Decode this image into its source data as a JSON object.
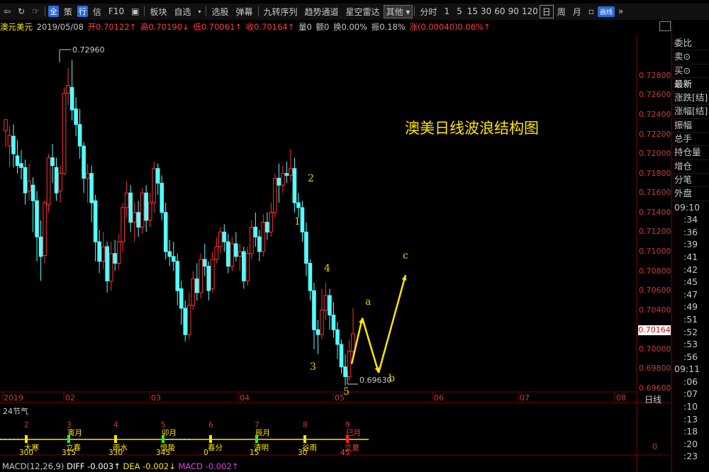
{
  "toolbar": {
    "items": [
      "全",
      "策",
      "行",
      "信",
      "F10",
      "板块",
      "自选",
      "选股",
      "弹幕",
      "九转序列",
      "趋势通道",
      "星空雷达",
      "其他"
    ],
    "periods": [
      "分时",
      "1",
      "5",
      "15",
      "30",
      "60",
      "90",
      "120",
      "日",
      "周",
      "月"
    ],
    "selected_period": "日",
    "tag": "画线"
  },
  "info": {
    "symbol": "澳元美元",
    "date": "2019/05/08",
    "open": "开0.70122↑",
    "high": "高0.70190↓",
    "low": "低0.70061↑",
    "close": "收0.70164↑",
    "volume": "量0",
    "amount": "额0",
    "turnover": "换0.00%",
    "amplitude": "振0.18%",
    "change": "涨(0.00040)0.06%↑"
  },
  "right_panel": {
    "fields": [
      "委比",
      "卖⊙",
      "买⊙",
      "最新",
      "涨跌[结]",
      "涨幅[结]",
      "振幅",
      "总手",
      "持仓量",
      "增仓",
      "分笔",
      "外盘"
    ],
    "time_header": "09:10",
    "ticks": [
      ":34",
      ":36",
      ":39",
      ":41",
      ":42",
      ":45",
      ":47",
      ":49",
      ":51",
      ":52",
      ":53",
      ":56"
    ],
    "time_header2": "09:11",
    "ticks2": [
      ":06",
      ":07",
      ":10",
      ":13",
      ":18",
      ":20",
      ":23"
    ]
  },
  "annotation_title": "澳美日线波浪结构图",
  "wave_labels": [
    "1",
    "2",
    "3",
    "4",
    "5",
    "a",
    "b",
    "c"
  ],
  "high_label": "0.72960",
  "low_label": "0.69630",
  "current_price": "0.70164",
  "period_label": "日线",
  "solar_terms": {
    "title": "24节气",
    "months": [
      "寅月",
      "卯月",
      "辰月",
      "巳月"
    ],
    "terms": [
      "大寒",
      "立春",
      "雨水",
      "惊蛰",
      "春分",
      "清明",
      "谷雨",
      "立夏"
    ],
    "numbers_top": [
      "2",
      "3",
      "4",
      "5",
      "6",
      "7",
      "8",
      "9"
    ],
    "numbers_bottom": [
      "300",
      "315",
      "330",
      "345",
      "0",
      "15",
      "30",
      "45"
    ],
    "value": "0"
  },
  "macd": {
    "label": "MACD(12,26,9)",
    "diff": "DIFF -0.003↑",
    "dea": "DEA -0.002↓",
    "macd": "MACD -0.002↑"
  },
  "chart_data": {
    "type": "candlestick",
    "title": "澳美日线波浪结构图",
    "y_axis_ticks": [
      "0.72800",
      "0.72600",
      "0.72400",
      "0.72200",
      "0.72000",
      "0.71800",
      "0.71600",
      "0.71400",
      "0.71200",
      "0.71000",
      "0.70800",
      "0.70600",
      "0.70400",
      "0.70200",
      "0.70000",
      "0.69800",
      "0.69600"
    ],
    "x_axis_ticks": [
      "2019",
      "02",
      "03",
      "04",
      "05",
      "06",
      "07",
      "08"
    ],
    "ylim": [
      0.6955,
      0.7318
    ],
    "candles": [
      [
        0.7224,
        0.7235,
        0.7212,
        0.7207
      ],
      [
        0.7208,
        0.7219,
        0.7228,
        0.7186
      ],
      [
        0.7218,
        0.72,
        0.723,
        0.7186
      ],
      [
        0.7198,
        0.7188,
        0.7214,
        0.718
      ],
      [
        0.719,
        0.7186,
        0.7204,
        0.7174
      ],
      [
        0.7186,
        0.716,
        0.7194,
        0.7148
      ],
      [
        0.7162,
        0.7172,
        0.719,
        0.7152
      ],
      [
        0.7168,
        0.7152,
        0.7176,
        0.712
      ],
      [
        0.7152,
        0.7115,
        0.7162,
        0.709
      ],
      [
        0.7115,
        0.7095,
        0.7132,
        0.707
      ],
      [
        0.7096,
        0.715,
        0.7152,
        0.7088
      ],
      [
        0.7148,
        0.7196,
        0.72,
        0.714
      ],
      [
        0.7196,
        0.7188,
        0.721,
        0.717
      ],
      [
        0.7186,
        0.716,
        0.7196,
        0.7152
      ],
      [
        0.7162,
        0.718,
        0.7188,
        0.715
      ],
      [
        0.718,
        0.7262,
        0.7268,
        0.7178
      ],
      [
        0.7262,
        0.727,
        0.7288,
        0.725
      ],
      [
        0.7268,
        0.7245,
        0.7296,
        0.7234
      ],
      [
        0.7246,
        0.723,
        0.7258,
        0.7218
      ],
      [
        0.723,
        0.7208,
        0.7246,
        0.7195
      ],
      [
        0.7208,
        0.7175,
        0.7212,
        0.716
      ],
      [
        0.7175,
        0.718,
        0.719,
        0.715
      ],
      [
        0.718,
        0.715,
        0.7188,
        0.713
      ],
      [
        0.7152,
        0.711,
        0.7158,
        0.709
      ],
      [
        0.711,
        0.709,
        0.7122,
        0.7078
      ],
      [
        0.709,
        0.7105,
        0.712,
        0.7082
      ],
      [
        0.7105,
        0.707,
        0.711,
        0.7058
      ],
      [
        0.707,
        0.7098,
        0.711,
        0.706
      ],
      [
        0.7098,
        0.7088,
        0.7112,
        0.708
      ],
      [
        0.7088,
        0.711,
        0.7118,
        0.7082
      ],
      [
        0.711,
        0.7145,
        0.715,
        0.71
      ],
      [
        0.7145,
        0.716,
        0.7172,
        0.7135
      ],
      [
        0.716,
        0.713,
        0.7168,
        0.712
      ],
      [
        0.713,
        0.714,
        0.715,
        0.711
      ],
      [
        0.714,
        0.7125,
        0.7152,
        0.7115
      ],
      [
        0.7125,
        0.716,
        0.7165,
        0.7118
      ],
      [
        0.716,
        0.7132,
        0.7168,
        0.712
      ],
      [
        0.7132,
        0.715,
        0.716,
        0.7125
      ],
      [
        0.715,
        0.7185,
        0.7192,
        0.714
      ],
      [
        0.7185,
        0.717,
        0.719,
        0.7158
      ],
      [
        0.717,
        0.714,
        0.7178,
        0.7132
      ],
      [
        0.714,
        0.71,
        0.715,
        0.7092
      ],
      [
        0.71,
        0.7095,
        0.7112,
        0.7085
      ],
      [
        0.7095,
        0.709,
        0.711,
        0.708
      ],
      [
        0.709,
        0.706,
        0.7098,
        0.7045
      ],
      [
        0.7062,
        0.7042,
        0.707,
        0.7025
      ],
      [
        0.7042,
        0.7015,
        0.705,
        0.7008
      ],
      [
        0.7015,
        0.7045,
        0.7058,
        0.701
      ],
      [
        0.7045,
        0.7072,
        0.708,
        0.704
      ],
      [
        0.7072,
        0.7058,
        0.7088,
        0.705
      ],
      [
        0.7058,
        0.7092,
        0.7098,
        0.7052
      ],
      [
        0.7092,
        0.7085,
        0.7108,
        0.7075
      ],
      [
        0.7085,
        0.706,
        0.709,
        0.705
      ],
      [
        0.7062,
        0.7092,
        0.71,
        0.7058
      ],
      [
        0.7092,
        0.7105,
        0.7115,
        0.7088
      ],
      [
        0.7105,
        0.712,
        0.7125,
        0.7098
      ],
      [
        0.712,
        0.711,
        0.7128,
        0.71
      ],
      [
        0.711,
        0.7085,
        0.7118,
        0.7078
      ],
      [
        0.7085,
        0.7108,
        0.7115,
        0.708
      ],
      [
        0.7108,
        0.7095,
        0.712,
        0.709
      ],
      [
        0.7095,
        0.71,
        0.7108,
        0.708
      ],
      [
        0.71,
        0.707,
        0.7105,
        0.7062
      ],
      [
        0.707,
        0.7098,
        0.7105,
        0.7065
      ],
      [
        0.7098,
        0.7125,
        0.7132,
        0.7092
      ],
      [
        0.7125,
        0.7115,
        0.714,
        0.7105
      ],
      [
        0.7115,
        0.71,
        0.7122,
        0.709
      ],
      [
        0.71,
        0.713,
        0.7138,
        0.7095
      ],
      [
        0.713,
        0.712,
        0.714,
        0.7112
      ],
      [
        0.712,
        0.714,
        0.715,
        0.7115
      ],
      [
        0.714,
        0.7175,
        0.718,
        0.7135
      ],
      [
        0.7175,
        0.7168,
        0.719,
        0.715
      ],
      [
        0.7168,
        0.718,
        0.7188,
        0.716
      ],
      [
        0.718,
        0.7178,
        0.7192,
        0.717
      ],
      [
        0.7178,
        0.7185,
        0.7205,
        0.7172
      ],
      [
        0.7185,
        0.715,
        0.7196,
        0.714
      ],
      [
        0.715,
        0.7145,
        0.716,
        0.7135
      ],
      [
        0.7145,
        0.712,
        0.7152,
        0.711
      ],
      [
        0.712,
        0.7088,
        0.713,
        0.7075
      ],
      [
        0.7088,
        0.706,
        0.7092,
        0.705
      ],
      [
        0.706,
        0.702,
        0.7068,
        0.7
      ],
      [
        0.702,
        0.7015,
        0.703,
        0.6995
      ],
      [
        0.7015,
        0.704,
        0.7062,
        0.701
      ],
      [
        0.704,
        0.7055,
        0.7068,
        0.703
      ],
      [
        0.7055,
        0.7035,
        0.7062,
        0.702
      ],
      [
        0.7035,
        0.702,
        0.7048,
        0.7012
      ],
      [
        0.702,
        0.7005,
        0.7028,
        0.699
      ],
      [
        0.7005,
        0.6982,
        0.701,
        0.6975
      ],
      [
        0.6982,
        0.6972,
        0.6995,
        0.6963
      ],
      [
        0.6972,
        0.6998,
        0.701,
        0.6968
      ],
      [
        0.6998,
        0.7016,
        0.7042,
        0.699
      ]
    ],
    "wave_path": [
      [
        0.6985,
        "5"
      ],
      [
        0.7032,
        "a"
      ],
      [
        0.6976,
        "b"
      ],
      [
        0.7076,
        "c"
      ]
    ],
    "solar_terms": [
      "大寒",
      "立春",
      "雨水",
      "惊蛰",
      "春分",
      "清明",
      "谷雨",
      "立夏"
    ]
  }
}
